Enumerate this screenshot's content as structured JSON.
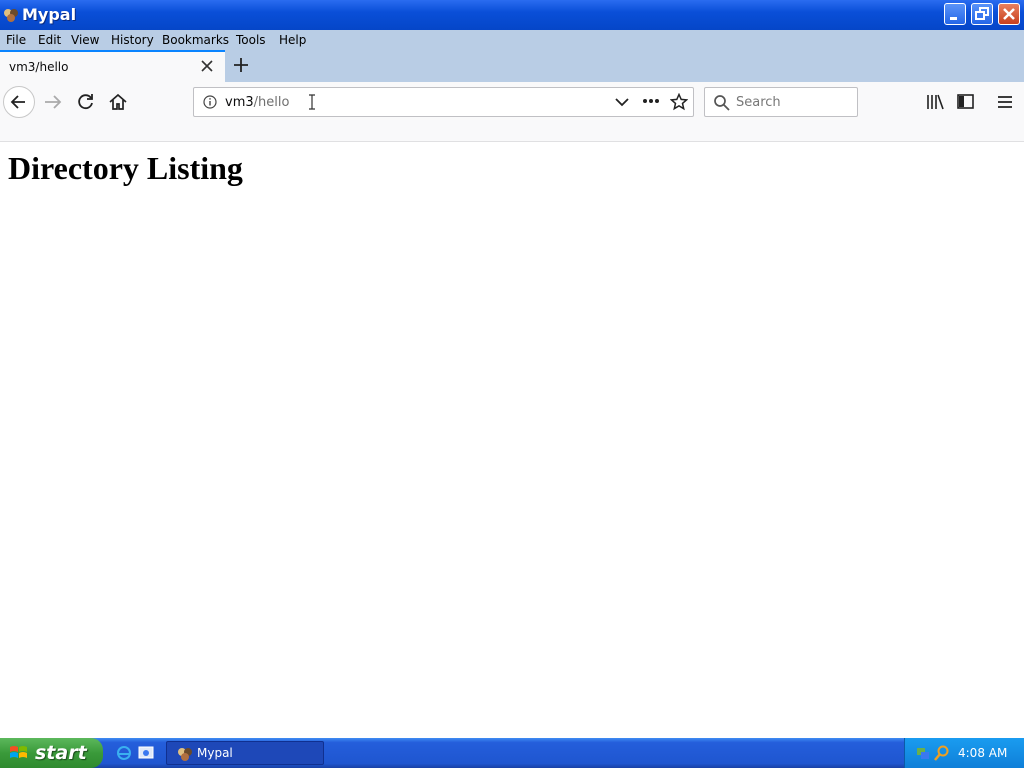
{
  "window": {
    "title": "Mypal"
  },
  "menu": [
    "File",
    "Edit",
    "View",
    "History",
    "Bookmarks",
    "Tools",
    "Help"
  ],
  "tab": {
    "title": "vm3/hello"
  },
  "urlbar": {
    "host": "vm3",
    "path": "/hello"
  },
  "search": {
    "placeholder": "Search"
  },
  "page": {
    "heading": "Directory Listing"
  },
  "taskbar": {
    "start_label": "start",
    "task_label": "Mypal",
    "clock": "4:08 AM"
  },
  "colors": {
    "titlebar": "#0a4fd8",
    "menubar": "#b9cde5",
    "tab_accent": "#0a84ff",
    "taskbar": "#245edb",
    "start": "#3a9a3a"
  }
}
